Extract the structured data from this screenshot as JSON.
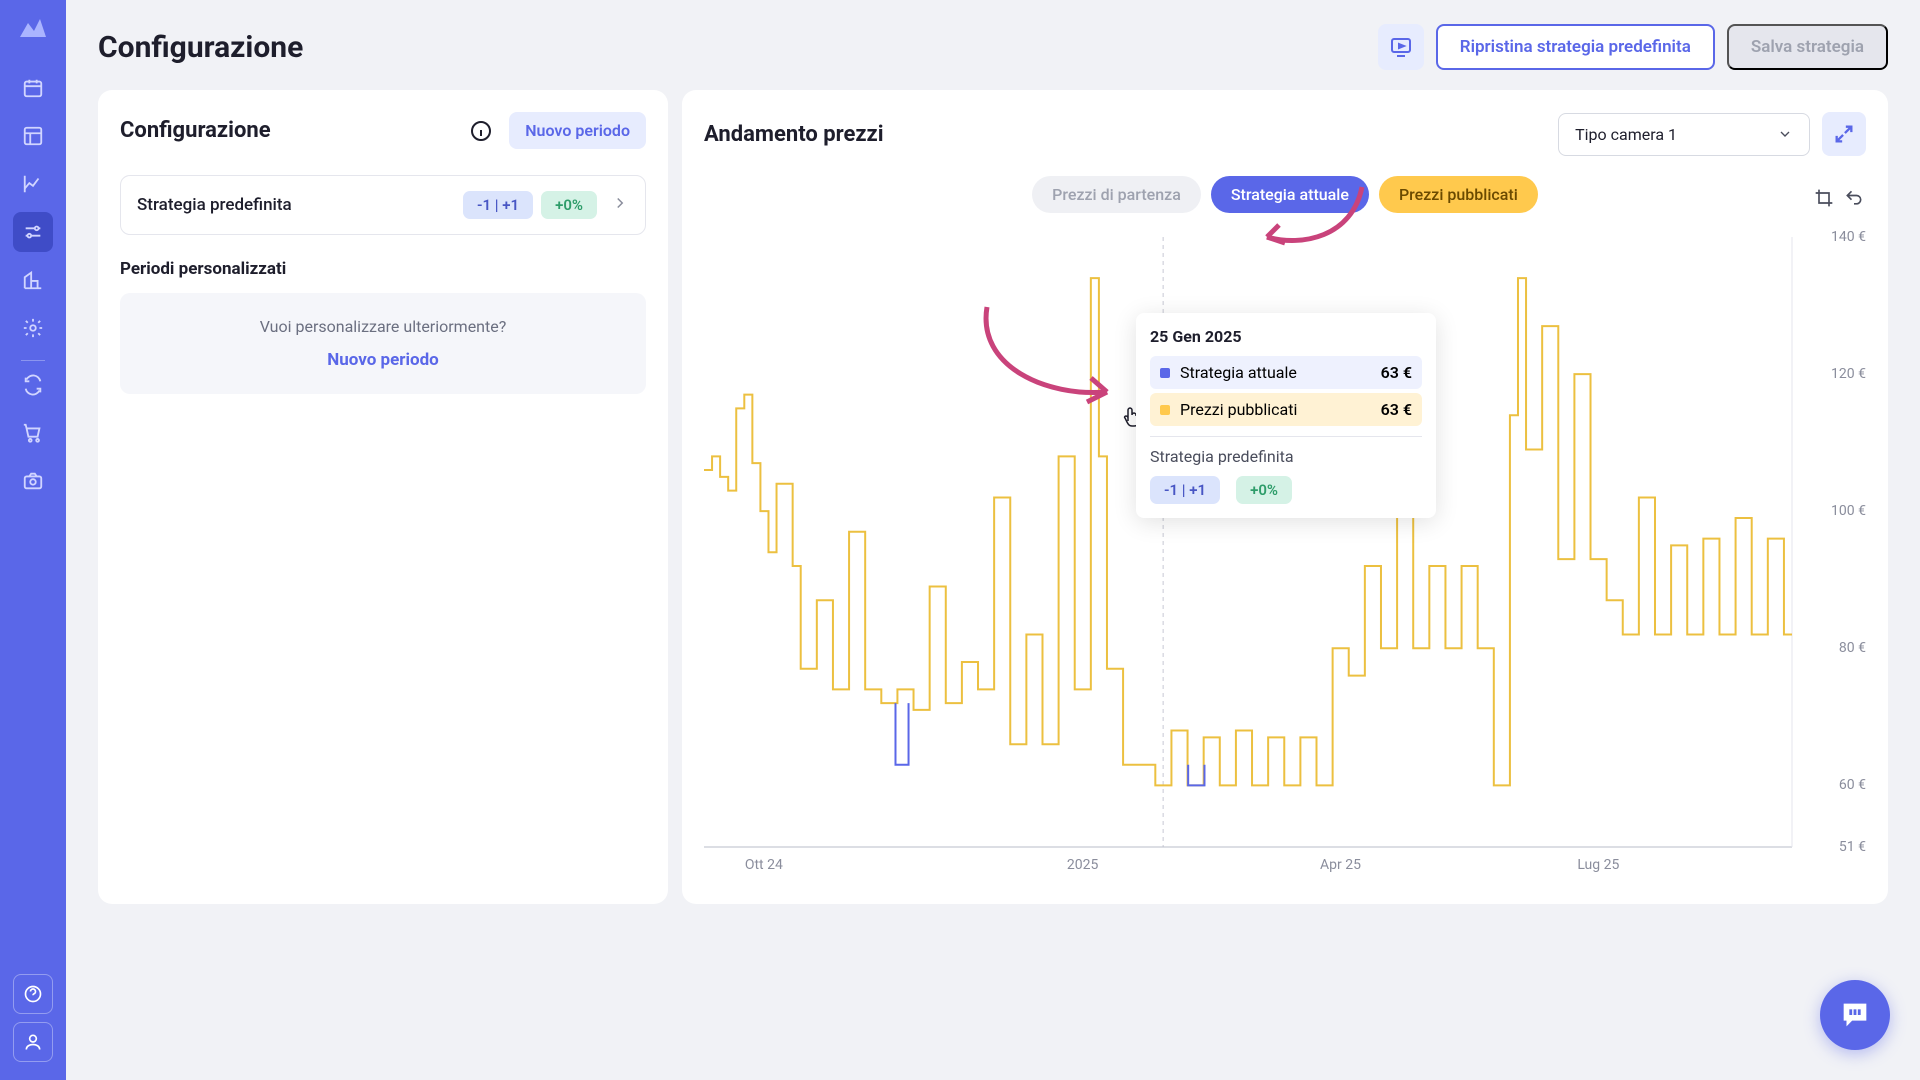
{
  "header": {
    "title": "Configurazione",
    "restore": "Ripristina strategia predefinita",
    "save": "Salva strategia"
  },
  "left": {
    "title": "Configurazione",
    "new_period": "Nuovo periodo",
    "strategy_label": "Strategia predefinita",
    "pill_range": "-1 | +1",
    "pill_pct": "+0%",
    "custom_title": "Periodi personalizzati",
    "custom_prompt": "Vuoi personalizzare ulteriormente?",
    "custom_link": "Nuovo periodo"
  },
  "right": {
    "title": "Andamento prezzi",
    "room_select": "Tipo camera 1",
    "chips": {
      "starting": "Prezzi di partenza",
      "current": "Strategia attuale",
      "published": "Prezzi pubblicati"
    }
  },
  "tooltip": {
    "date": "25 Gen 2025",
    "current_label": "Strategia attuale",
    "current_val": "63 €",
    "published_label": "Prezzi pubblicati",
    "published_val": "63 €",
    "sub": "Strategia predefinita",
    "pill_range": "-1 | +1",
    "pill_pct": "+0%"
  },
  "colors": {
    "accent": "#5a67e8",
    "yellow": "#ffc94d",
    "arrow": "#c9437b"
  },
  "chart_data": {
    "type": "line",
    "title": "Andamento prezzi",
    "xlabel": "",
    "ylabel": "",
    "ylim": [
      51,
      140
    ],
    "y_ticks": [
      140,
      120,
      100,
      80,
      60,
      51
    ],
    "x_ticks": [
      "Ott 24",
      "2025",
      "Apr 25",
      "Lug 25"
    ],
    "x_tick_positions_pct": [
      5.5,
      34.8,
      58.5,
      82.2
    ],
    "hover_x_pct": 42.2,
    "series": [
      {
        "name": "Prezzi pubblicati",
        "color": "#ecc040",
        "values": [
          106,
          108,
          105,
          103,
          115,
          117,
          107,
          100,
          94,
          104,
          104,
          92,
          77,
          77,
          87,
          87,
          74,
          74,
          97,
          97,
          74,
          74,
          72,
          72,
          74,
          74,
          71,
          71,
          89,
          89,
          72,
          72,
          78,
          78,
          74,
          74,
          102,
          102,
          66,
          66,
          82,
          82,
          66,
          66,
          108,
          108,
          74,
          74,
          134,
          108,
          77,
          77,
          63,
          63,
          63,
          63,
          60,
          60,
          68,
          68,
          60,
          60,
          67,
          67,
          60,
          60,
          68,
          68,
          60,
          60,
          67,
          67,
          60,
          60,
          67,
          67,
          60,
          60,
          80,
          80,
          76,
          76,
          92,
          92,
          80,
          80,
          109,
          109,
          80,
          80,
          92,
          92,
          80,
          80,
          92,
          92,
          80,
          80,
          60,
          60,
          114,
          134,
          109,
          109,
          127,
          127,
          93,
          93,
          120,
          120,
          93,
          93,
          87,
          87,
          82,
          82,
          102,
          102,
          82,
          82,
          95,
          95,
          82,
          82,
          96,
          96,
          82,
          82,
          99,
          99,
          82,
          82,
          96,
          96,
          82,
          82
        ]
      },
      {
        "name": "Strategia attuale",
        "color": "#5a67e8",
        "values": []
      }
    ],
    "blue_segments": [
      {
        "x_start_pct": 17.6,
        "x_end_pct": 18.8,
        "y_start": 72,
        "y_end": 63
      },
      {
        "x_start_pct": 44.5,
        "x_end_pct": 46.0,
        "y_start": 63,
        "y_end": 60
      }
    ]
  }
}
